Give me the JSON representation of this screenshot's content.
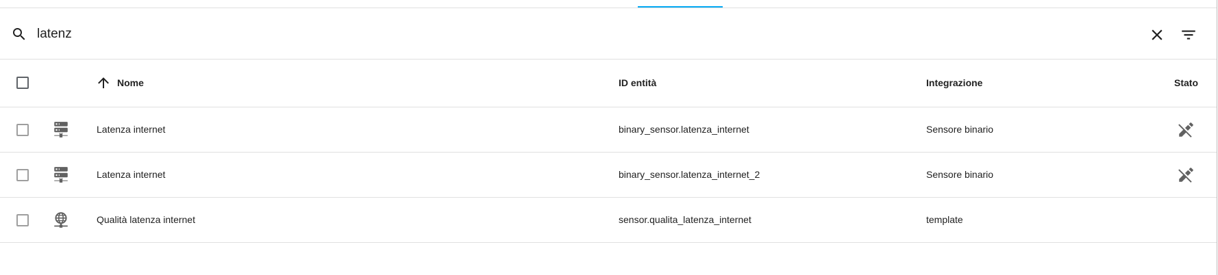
{
  "search": {
    "value": "latenz"
  },
  "table": {
    "headers": {
      "name": "Nome",
      "entity_id": "ID entità",
      "integration": "Integrazione",
      "status": "Stato"
    },
    "rows": [
      {
        "icon": "server-icon",
        "name": "Latenza internet",
        "entity_id": "binary_sensor.latenza_internet",
        "integration": "Sensore binario",
        "status_icon": "pencil-off-icon"
      },
      {
        "icon": "server-icon",
        "name": "Latenza internet",
        "entity_id": "binary_sensor.latenza_internet_2",
        "integration": "Sensore binario",
        "status_icon": "pencil-off-icon"
      },
      {
        "icon": "web-icon",
        "name": "Qualità latenza internet",
        "entity_id": "sensor.qualita_latenza_internet",
        "integration": "template",
        "status_icon": ""
      }
    ]
  },
  "colors": {
    "accent": "#03a9f4",
    "icon": "#616161",
    "divider": "#e0e0e0"
  }
}
